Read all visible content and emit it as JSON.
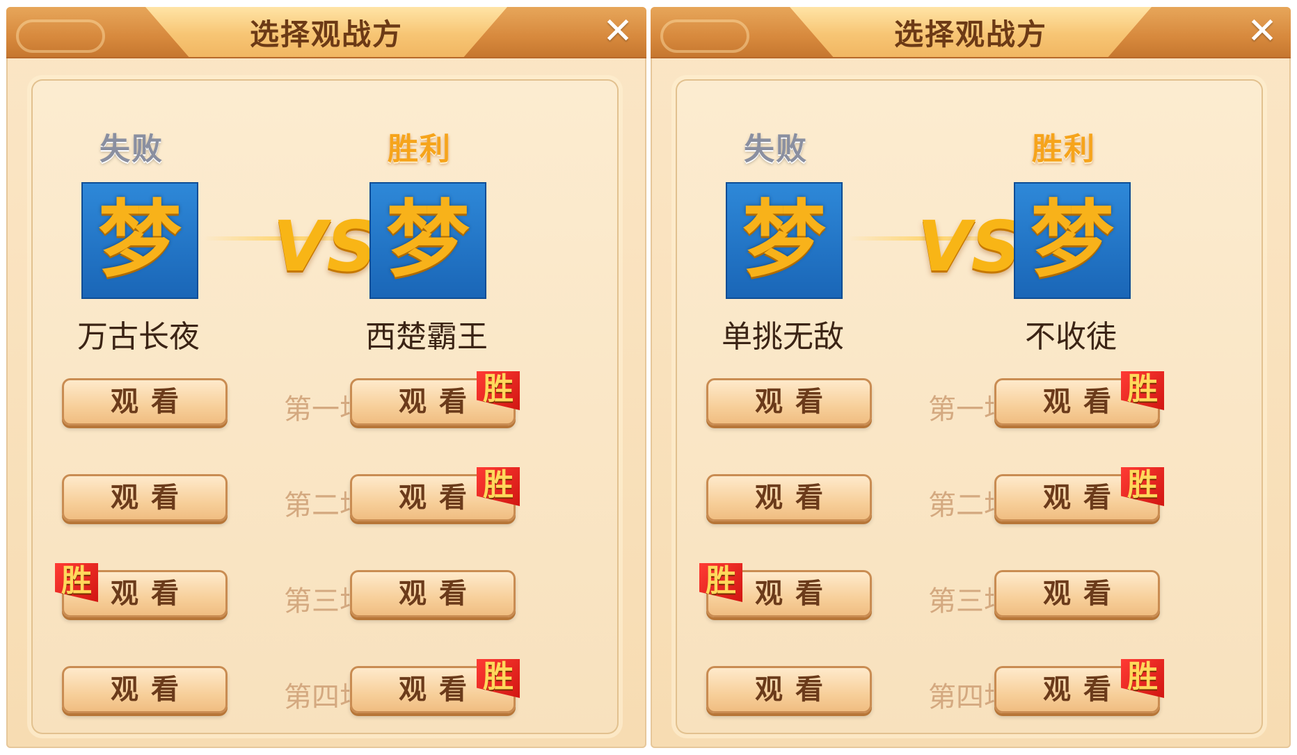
{
  "panels": [
    {
      "title": "选择观战方",
      "close_glyph": "✕",
      "left": {
        "result": "失败",
        "avatar_glyph": "梦",
        "name": "万古长夜"
      },
      "vs": "VS",
      "right": {
        "result": "胜利",
        "avatar_glyph": "梦",
        "name": "西楚霸王"
      },
      "watch_label": "观看",
      "win_badge": "胜",
      "rounds": [
        {
          "label": "第一场",
          "winner": "right"
        },
        {
          "label": "第二场",
          "winner": "right"
        },
        {
          "label": "第三场",
          "winner": "left"
        },
        {
          "label": "第四场",
          "winner": "right"
        }
      ]
    },
    {
      "title": "选择观战方",
      "close_glyph": "✕",
      "left": {
        "result": "失败",
        "avatar_glyph": "梦",
        "name": "单挑无敌"
      },
      "vs": "VS",
      "right": {
        "result": "胜利",
        "avatar_glyph": "梦",
        "name": "不收徒"
      },
      "watch_label": "观看",
      "win_badge": "胜",
      "rounds": [
        {
          "label": "第一场",
          "winner": "right"
        },
        {
          "label": "第二场",
          "winner": "right"
        },
        {
          "label": "第三场",
          "winner": "left"
        },
        {
          "label": "第四场",
          "winner": "right"
        }
      ]
    }
  ],
  "colors": {
    "title_bar": "#d7893d",
    "panel_bg": "#f8e1bd",
    "avatar_blue": "#1a66b7",
    "win_gold": "#f6a41b",
    "lose_gray": "#8a8fa0",
    "win_badge_red": "#d11612"
  }
}
